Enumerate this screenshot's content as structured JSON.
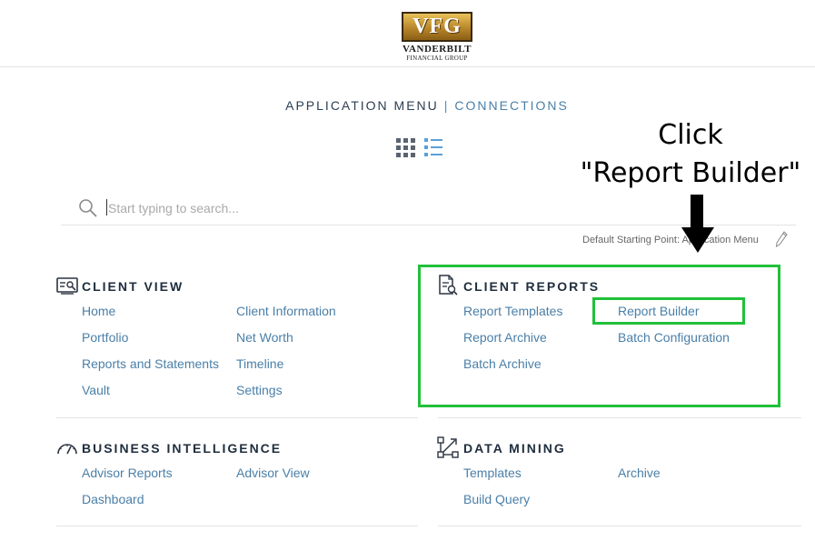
{
  "header": {
    "logo_mark": "VFG",
    "logo_line1": "VANDERBILT",
    "logo_line2": "FINANCIAL GROUP"
  },
  "menu_switch": {
    "active": "APPLICATION MENU",
    "separator": "|",
    "other": "CONNECTIONS"
  },
  "view_toggle": {
    "grid_icon": "grid-view-icon",
    "list_icon": "list-view-icon"
  },
  "search": {
    "placeholder": "Start typing to search...",
    "value": ""
  },
  "default_start": {
    "text": "Default Starting Point: Application Menu",
    "edit_icon": "pencil-icon"
  },
  "sections": {
    "client_view": {
      "title": "CLIENT VIEW",
      "icon": "client-card-icon",
      "links": [
        "Home",
        "Client Information",
        "Portfolio",
        "Net Worth",
        "Reports and Statements",
        "Timeline",
        "Vault",
        "Settings"
      ]
    },
    "client_reports": {
      "title": "CLIENT REPORTS",
      "icon": "report-document-icon",
      "links": [
        "Report Templates",
        "Report Builder",
        "Report Archive",
        "Batch Configuration",
        "Batch Archive"
      ]
    },
    "business_intelligence": {
      "title": "BUSINESS INTELLIGENCE",
      "icon": "gauge-icon",
      "links": [
        "Advisor Reports",
        "Advisor View",
        "Dashboard"
      ]
    },
    "data_mining": {
      "title": "DATA MINING",
      "icon": "data-mining-icon",
      "links": [
        "Templates",
        "Archive",
        "Build Query"
      ]
    }
  },
  "annotation": {
    "line1": "Click",
    "line2": "\"Report Builder\"",
    "highlight_color": "#21c03a"
  }
}
